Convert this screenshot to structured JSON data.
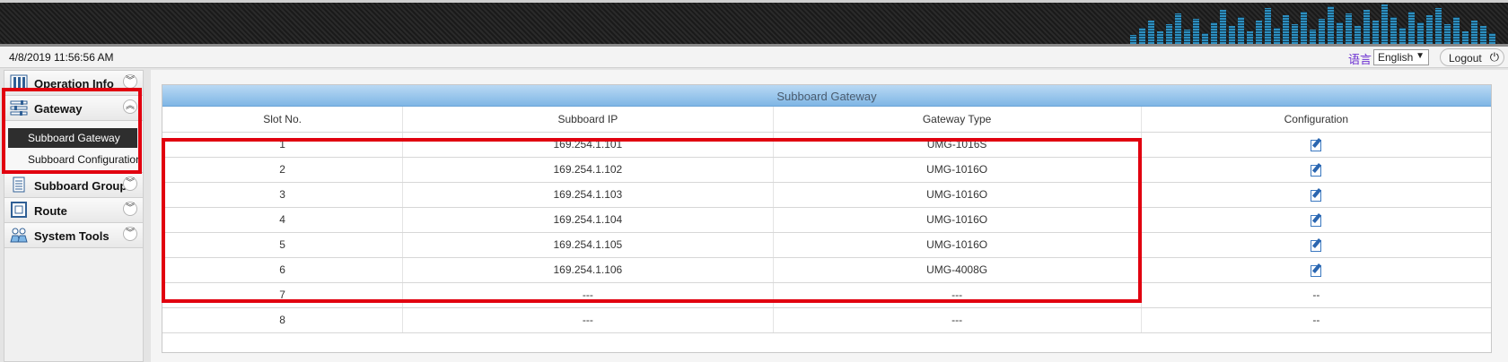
{
  "header": {
    "datetime": "4/8/2019 11:56:56 AM",
    "language_label": "语言",
    "language_value": "English",
    "logout_label": "Logout"
  },
  "sidebar": {
    "sections": [
      {
        "label": "Operation Info",
        "icon": "operation-info-icon"
      },
      {
        "label": "Gateway",
        "icon": "gateway-icon"
      },
      {
        "label": "Subboard Group",
        "icon": "subboard-group-icon"
      },
      {
        "label": "Route",
        "icon": "route-icon"
      },
      {
        "label": "System Tools",
        "icon": "system-tools-icon"
      }
    ],
    "gateway_items": [
      {
        "label": "Subboard Gateway"
      },
      {
        "label": "Subboard Configuration"
      }
    ]
  },
  "table": {
    "title": "Subboard Gateway",
    "columns": [
      "Slot No.",
      "Subboard IP",
      "Gateway Type",
      "Configuration"
    ],
    "rows": [
      {
        "slot": "1",
        "ip": "169.254.1.101",
        "type": "UMG-1016S",
        "config": "edit"
      },
      {
        "slot": "2",
        "ip": "169.254.1.102",
        "type": "UMG-1016O",
        "config": "edit"
      },
      {
        "slot": "3",
        "ip": "169.254.1.103",
        "type": "UMG-1016O",
        "config": "edit"
      },
      {
        "slot": "4",
        "ip": "169.254.1.104",
        "type": "UMG-1016O",
        "config": "edit"
      },
      {
        "slot": "5",
        "ip": "169.254.1.105",
        "type": "UMG-1016O",
        "config": "edit"
      },
      {
        "slot": "6",
        "ip": "169.254.1.106",
        "type": "UMG-4008G",
        "config": "edit"
      },
      {
        "slot": "7",
        "ip": "---",
        "type": "---",
        "config": "--"
      },
      {
        "slot": "8",
        "ip": "---",
        "type": "---",
        "config": "--"
      }
    ]
  },
  "colors": {
    "highlight": "#e1000f",
    "title_bar": "#7fb6e5",
    "active_item": "#2e2e2e"
  }
}
